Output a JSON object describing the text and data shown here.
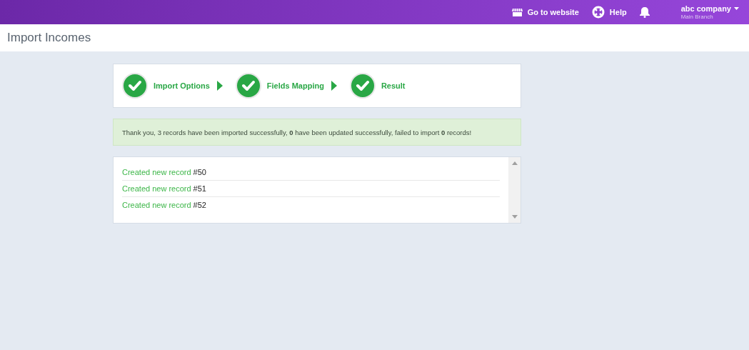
{
  "top_bar": {
    "website_link": "Go to website",
    "help_link": "Help",
    "company": "abc company",
    "branch": "Main Branch"
  },
  "page_title": "Import Incomes",
  "steps": [
    {
      "label": "Import Options",
      "completed": true
    },
    {
      "label": "Fields Mapping",
      "completed": true
    },
    {
      "label": "Result",
      "completed": true
    }
  ],
  "alert": "Thank you, 3 records have been imported successfully, **0** have been updated successfully, failed to import **0** records!",
  "log": [
    {
      "status": "Created new record",
      "record": "#50"
    },
    {
      "status": "Created new record",
      "record": "#51"
    },
    {
      "status": "Created new record",
      "record": "#52"
    }
  ]
}
